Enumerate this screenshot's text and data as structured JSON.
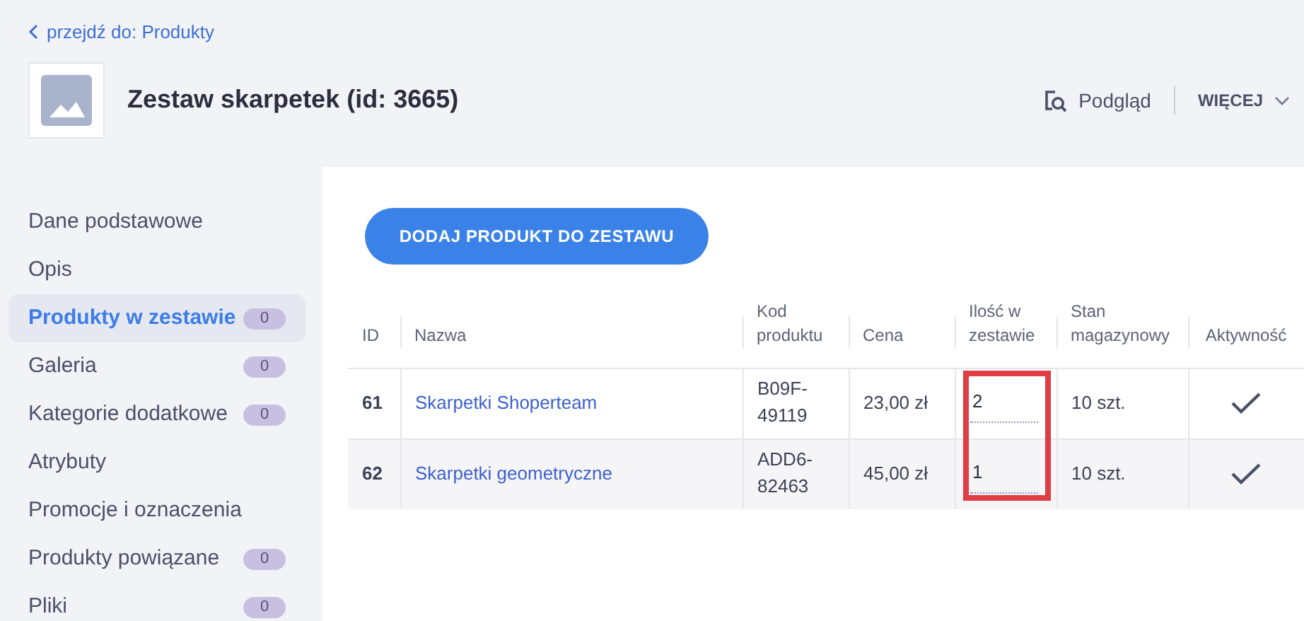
{
  "back_link": {
    "label": "przejdź do: Produkty"
  },
  "product": {
    "title": "Zestaw skarpetek (id: 3665)"
  },
  "actions": {
    "preview": "Podgląd",
    "more": "WIĘCEJ"
  },
  "sidebar": {
    "items": [
      {
        "label": "Dane podstawowe",
        "selected": false
      },
      {
        "label": "Opis",
        "selected": false
      },
      {
        "label": "Produkty w zestawie",
        "selected": true,
        "count": "0"
      },
      {
        "label": "Galeria",
        "selected": false,
        "count": "0"
      },
      {
        "label": "Kategorie dodatkowe",
        "selected": false,
        "count": "0"
      },
      {
        "label": "Atrybuty",
        "selected": false
      },
      {
        "label": "Promocje i oznaczenia",
        "selected": false
      },
      {
        "label": "Produkty powiązane",
        "selected": false,
        "count": "0"
      },
      {
        "label": "Pliki",
        "selected": false,
        "count": "0"
      }
    ]
  },
  "add_button": "DODAJ PRODUKT DO ZESTAWU",
  "table": {
    "columns": [
      {
        "label": "ID",
        "highlighted": false
      },
      {
        "label": "Nazwa",
        "highlighted": false
      },
      {
        "label": "Kod produktu",
        "highlighted": false
      },
      {
        "label": "Cena",
        "highlighted": false
      },
      {
        "label": "Ilość w zestawie",
        "highlighted": true
      },
      {
        "label": "Stan magazynowy",
        "highlighted": false
      },
      {
        "label": "Aktywność",
        "highlighted": false
      }
    ],
    "rows": [
      {
        "id": "61",
        "name": "Skarpetki Shoperteam",
        "code": "B09F-49119",
        "price": "23,00 zł",
        "quantity": "2",
        "stock": "10 szt.",
        "active": true
      },
      {
        "id": "62",
        "name": "Skarpetki geometryczne",
        "code": "ADD6-82463",
        "price": "45,00 zł",
        "quantity": "1",
        "stock": "10 szt.",
        "active": true
      }
    ]
  }
}
